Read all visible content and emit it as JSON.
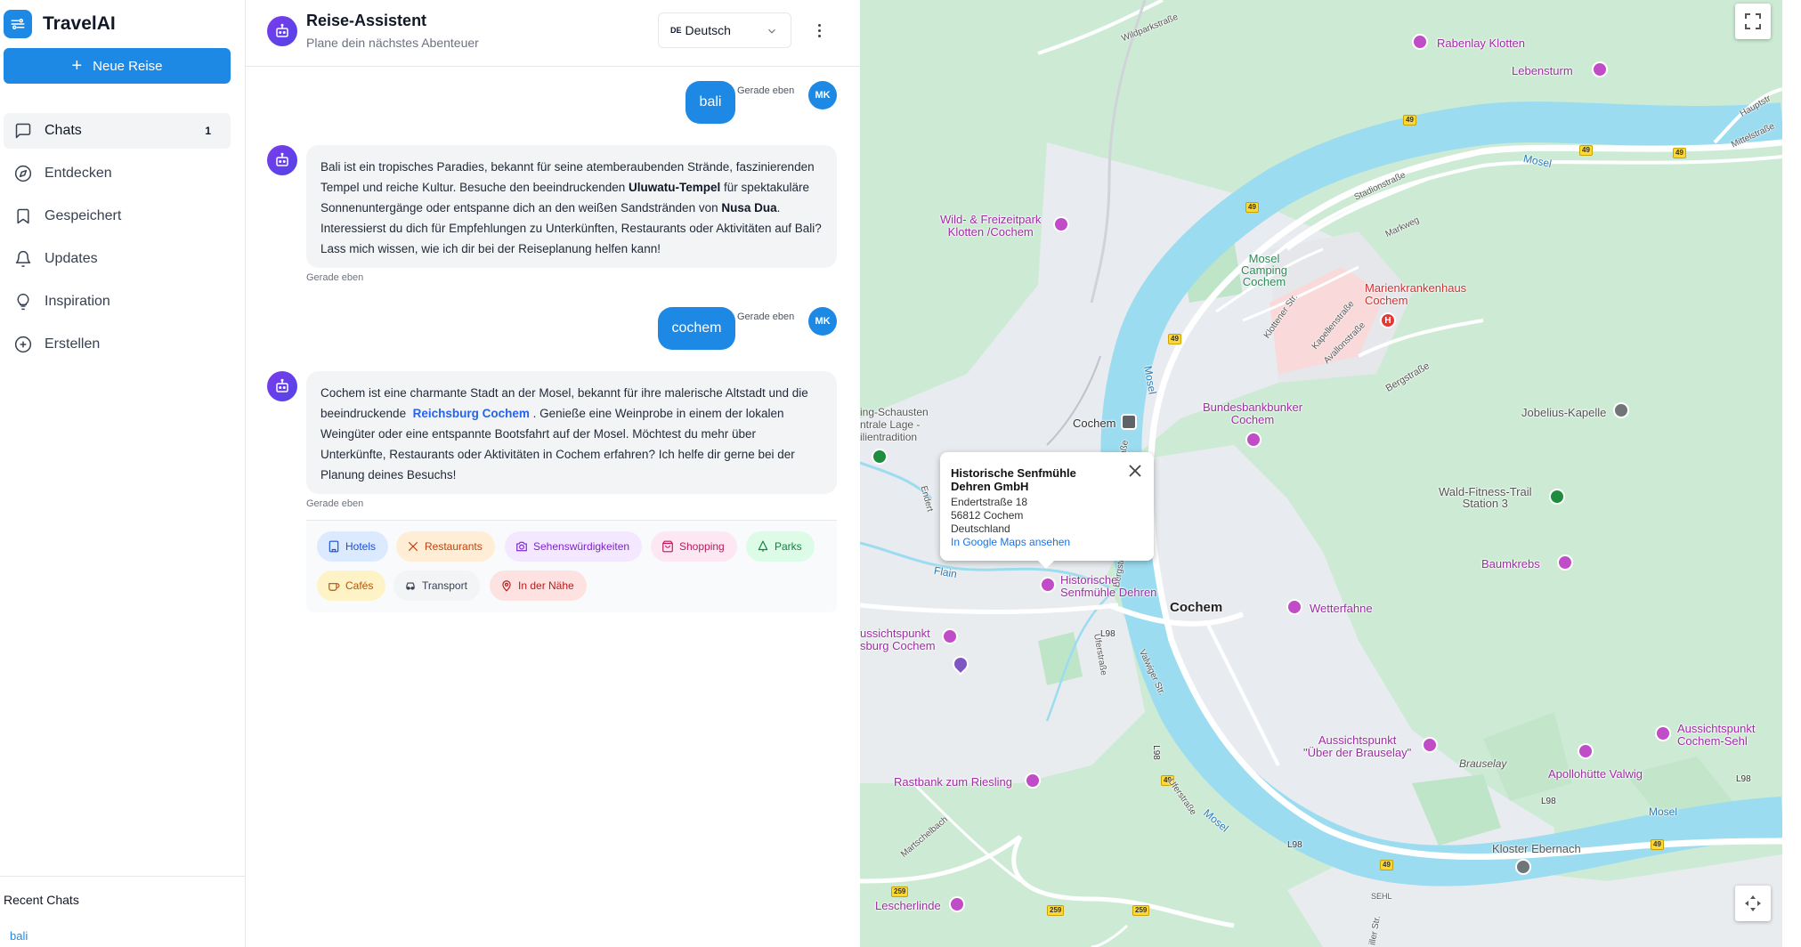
{
  "sidebar": {
    "brand": "TravelAI",
    "new_trip_label": "Neue Reise",
    "nav": [
      {
        "label": "Chats",
        "badge": "1"
      },
      {
        "label": "Entdecken"
      },
      {
        "label": "Gespeichert"
      },
      {
        "label": "Updates"
      },
      {
        "label": "Inspiration"
      },
      {
        "label": "Erstellen"
      }
    ],
    "recent_title": "Recent Chats",
    "recent_items": [
      "bali"
    ]
  },
  "chat": {
    "title": "Reise-Assistent",
    "subtitle": "Plane dein nächstes Abenteuer",
    "language": {
      "flag": "DE",
      "label": "Deutsch"
    },
    "user_initials": "MK",
    "messages": [
      {
        "role": "user",
        "text": "bali",
        "time": "Gerade eben"
      },
      {
        "role": "bot",
        "time": "Gerade eben",
        "parts": {
          "p1": "Bali ist ein tropisches Paradies, bekannt für seine atemberaubenden Strände, faszinierenden Tempel und reiche Kultur. Besuche den beeindruckenden ",
          "b1": "Uluwatu-Tempel",
          "p2": " für spektakuläre Sonnenuntergänge oder entspanne dich an den weißen Sandstränden von ",
          "b2": "Nusa Dua",
          "p3": ". Interessierst du dich für Empfehlungen zu Unterkünften, Restaurants oder Aktivitäten auf Bali? Lass mich wissen, wie ich dir bei der Reiseplanung helfen kann!"
        }
      },
      {
        "role": "user",
        "text": "cochem",
        "time": "Gerade eben"
      },
      {
        "role": "bot",
        "time": "Gerade eben",
        "parts": {
          "p1": "Cochem ist eine charmante Stadt an der Mosel, bekannt für ihre malerische Altstadt und die beeindruckende ",
          "b1": "Reichsburg Cochem",
          "p2": " . Genieße eine Weinprobe in einem der lokalen Weingüter oder eine entspannte Bootsfahrt auf der Mosel. Möchtest du mehr über Unterkünfte, Restaurants oder Aktivitäten in Cochem erfahren? Ich helfe dir gerne bei der Planung deines Besuchs!"
        }
      }
    ],
    "categories": [
      {
        "label": "Hotels",
        "icon": "building-icon",
        "bg": "#dbeafe",
        "fg": "#1d4ed8"
      },
      {
        "label": "Restaurants",
        "icon": "utensils-icon",
        "bg": "#ffedd5",
        "fg": "#c2410c"
      },
      {
        "label": "Sehenswürdigkeiten",
        "icon": "camera-icon",
        "bg": "#f3e8ff",
        "fg": "#7e22ce"
      },
      {
        "label": "Shopping",
        "icon": "shopping-bag-icon",
        "bg": "#fce7f3",
        "fg": "#be185d"
      },
      {
        "label": "Parks",
        "icon": "tree-icon",
        "bg": "#dcfce7",
        "fg": "#15803d"
      },
      {
        "label": "Cafés",
        "icon": "coffee-icon",
        "bg": "#fef3c7",
        "fg": "#b45309"
      },
      {
        "label": "Transport",
        "icon": "car-icon",
        "bg": "#f3f4f6",
        "fg": "#374151"
      },
      {
        "label": "In der Nähe",
        "icon": "map-pin-icon",
        "bg": "#fee2e2",
        "fg": "#b91c1c"
      }
    ]
  },
  "map": {
    "infowindow": {
      "title": "Historische Senfmühle Dehren GmbH",
      "street": "Endertstraße 18",
      "city": "56812 Cochem",
      "country": "Deutschland",
      "link": "In Google Maps ansehen"
    },
    "labels": {
      "rabenlay": "Rabenlay Klotten",
      "lebensturm": "Lebensturm",
      "wildpark": "Wild- & Freizeitpark\nKlotten /Cochem",
      "camping": "Mosel\nCamping\nCochem",
      "krankenhaus": "Marienkrankenhaus\nCochem",
      "bunker": "Bundesbankbunker\nCochem",
      "jobelius": "Jobelius-Kapelle",
      "fitness": "Wald-Fitness-Trail\nStation 3",
      "baumkrebs": "Baumkrebs",
      "wetterfahne": "Wetterfahne",
      "cochem_station": "Cochem",
      "cochem_town": "Cochem",
      "senfmuehle": "Historische\nSenfmühle Dehren",
      "aussicht_burg": "ussichtspunkt\nsburg Cochem",
      "aussicht_brauselay": "Aussichtspunkt\n\"Über der Brauselay\"",
      "aussicht_sehl": "Aussichtspunkt\nCochem-Sehl",
      "apollohuette": "Apollohütte Valwig",
      "brauselay": "Brauselay",
      "rastbank": "Rastbank zum Riesling",
      "kloster": "Kloster Ebernach",
      "lescherlinde": "Lescherlinde",
      "schausten": "ing-Schausten\nntrale Lage -\nilientradition",
      "mosel1": "Mosel",
      "mosel2": "Mosel",
      "mosel3": "Mosel",
      "mosel4": "Mosel",
      "flain": "Flain",
      "wildparkstr": "Wildparkstraße",
      "stadionstr": "Stadionstraße",
      "markweg": "Markweg",
      "klottener": "Klottener Str.",
      "kapellenstr": "Kapellenstraße",
      "avallonstr": "Avallonstraße",
      "bergstr1": "Bergstraße",
      "bergstr2": "Bergstraße",
      "stadionstr2": "Stadionstraße",
      "uferstr": "Uferstraße",
      "valwiger": "Valwiger Str.",
      "uferstr2": "Uferstraße",
      "martschelbach": "Martschelbach",
      "endert": "Endert",
      "hauptstr": "Hauptstr",
      "mittelstr": "Mittelstraße",
      "sehl": "SEHL",
      "willerstr": "iller Str.",
      "l98a": "L98",
      "l98b": "L98",
      "l98c": "L98",
      "l98d": "L98",
      "l98e": "L98"
    },
    "shields": [
      "49",
      "49",
      "49",
      "49",
      "49",
      "49",
      "49",
      "49",
      "259",
      "259",
      "259"
    ]
  }
}
